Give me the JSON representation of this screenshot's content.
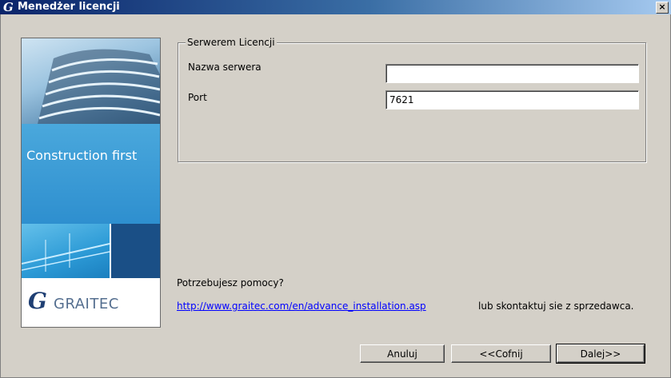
{
  "window": {
    "title": "Menedżer licencji",
    "close_glyph": "×"
  },
  "banner": {
    "tagline": "Construction first",
    "brand": "GRAITEC",
    "brand_mark": "G"
  },
  "license_server": {
    "group_label": "Serwerem Licencji",
    "server_name_label": "Nazwa serwera",
    "server_name_value": "",
    "port_label": "Port",
    "port_value": "7621"
  },
  "help": {
    "question": "Potrzebujesz pomocy?",
    "link_text": "http://www.graitec.com/en/advance_installation.asp",
    "contact_text": "lub skontaktuj sie z sprzedawca."
  },
  "buttons": {
    "cancel": "Anuluj",
    "back": "<<Cofnij",
    "next": "Dalej>>"
  }
}
